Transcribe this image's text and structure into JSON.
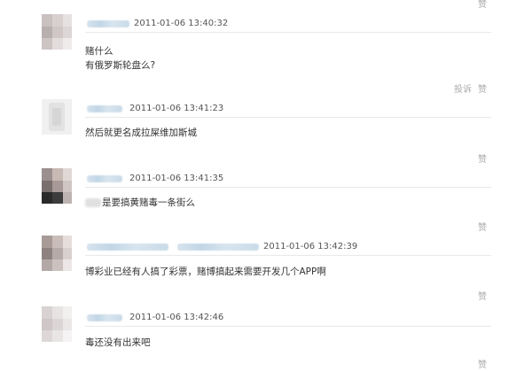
{
  "actions": {
    "report": "投诉",
    "like": "赞"
  },
  "comments": [
    {
      "timestamp": "2011-01-06 13:40:32",
      "lines": [
        "赌什么",
        "有俄罗斯轮盘么?"
      ]
    },
    {
      "timestamp": "2011-01-06 13:41:23",
      "lines": [
        "然后就更名成拉屎维加斯城"
      ]
    },
    {
      "timestamp": "2011-01-06 13:41:35",
      "lines": [
        "是要搞黄赌毒一条街么"
      ]
    },
    {
      "timestamp": "2011-01-06 13:42:39",
      "lines": [
        "博彩业已经有人搞了彩票，赌博搞起来需要开发几个APP啊"
      ]
    },
    {
      "timestamp": "2011-01-06 13:42:46",
      "lines": [
        "毒还没有出来吧"
      ]
    }
  ]
}
